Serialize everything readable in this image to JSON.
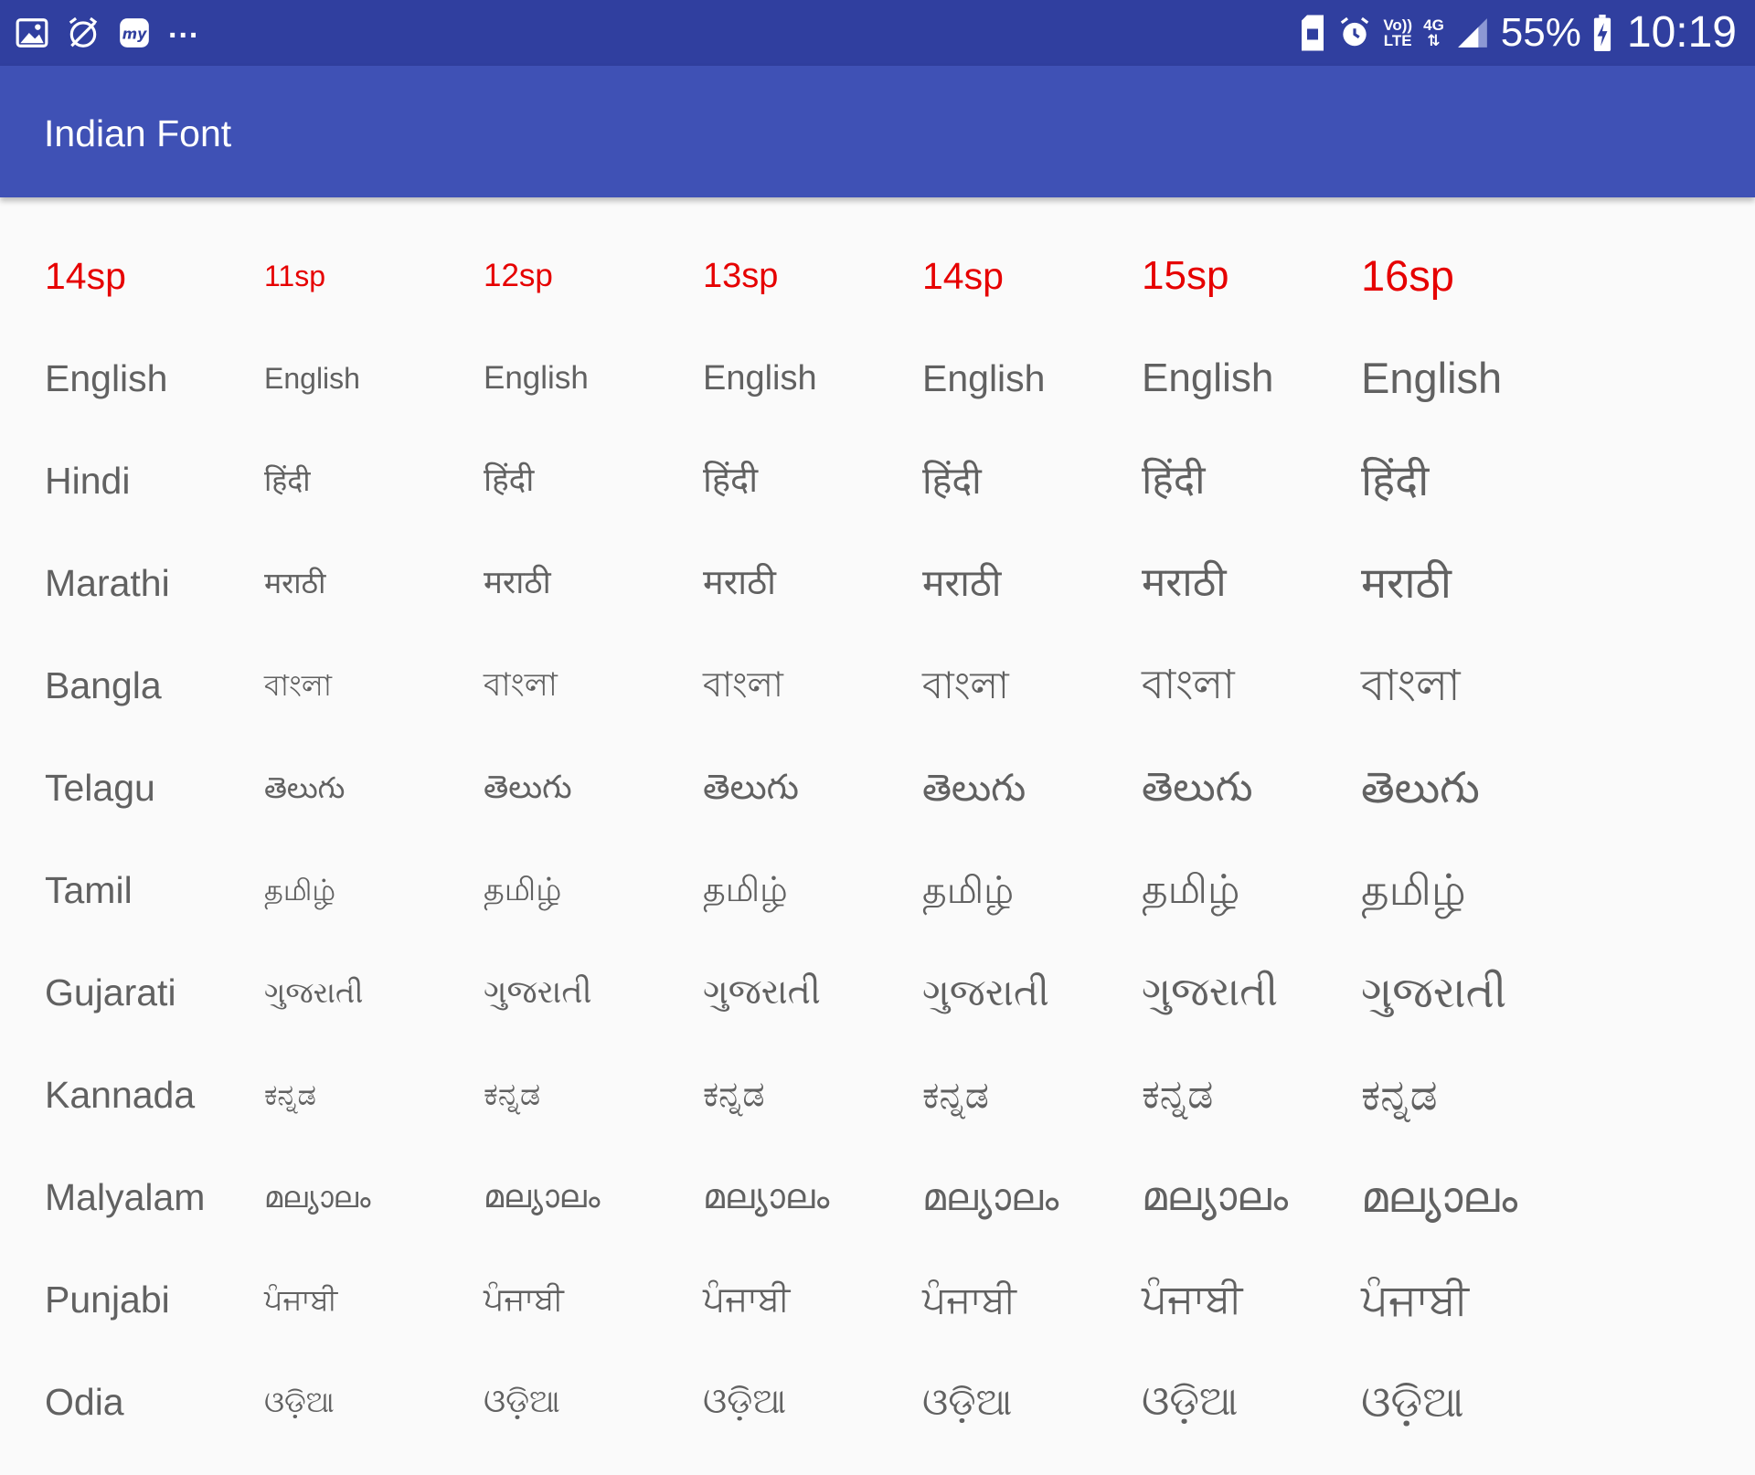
{
  "status_bar": {
    "left_icons": [
      "image-icon",
      "alarm-off-icon",
      "mytrip-icon"
    ],
    "more": "...",
    "volte_top": "Vo))",
    "volte_bottom": "LTE",
    "network": "4G",
    "battery": "55%",
    "time": "10:19"
  },
  "app_bar": {
    "title": "Indian Font",
    "color": "#3f51b5",
    "status_color": "#303f9f"
  },
  "table": {
    "header_color": "#e60000",
    "text_color": "#616161",
    "columns": [
      "14sp",
      "11sp",
      "12sp",
      "13sp",
      "14sp",
      "15sp",
      "16sp"
    ],
    "rows": [
      {
        "label": "English",
        "sample": "English"
      },
      {
        "label": "Hindi",
        "sample": "हिंदी"
      },
      {
        "label": "Marathi",
        "sample": "मराठी"
      },
      {
        "label": "Bangla",
        "sample": "বাংলা"
      },
      {
        "label": "Telagu",
        "sample": "తెలుగు"
      },
      {
        "label": "Tamil",
        "sample": "தமிழ்"
      },
      {
        "label": "Gujarati",
        "sample": "ગુજરાતી"
      },
      {
        "label": "Kannada",
        "sample": "ಕನ್ನಡ"
      },
      {
        "label": "Malyalam",
        "sample": "മല്യാലം"
      },
      {
        "label": "Punjabi",
        "sample": "ਪੰਜਾਬੀ"
      },
      {
        "label": "Odia",
        "sample": "ଓଡ଼ିଆ"
      }
    ]
  }
}
